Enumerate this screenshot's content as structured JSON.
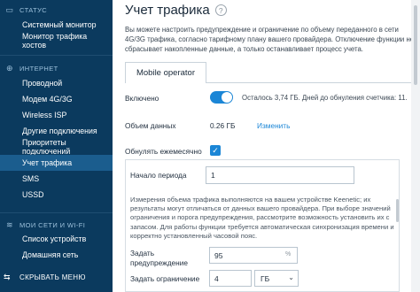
{
  "sidebar": {
    "status_header": "СТАТУС",
    "status_items": [
      "Системный монитор",
      "Монитор трафика хостов"
    ],
    "internet_header": "ИНТЕРНЕТ",
    "internet_items": [
      "Проводной",
      "Модем 4G/3G",
      "Wireless ISP",
      "Другие подключения",
      "Приоритеты подключений",
      "Учет трафика",
      "SMS",
      "USSD"
    ],
    "active_item": "Учет трафика",
    "wifi_header": "МОИ СЕТИ И WI-FI",
    "wifi_items": [
      "Список устройств",
      "Домашняя сеть"
    ],
    "collapse_label": "СКРЫВАТЬ МЕНЮ"
  },
  "main": {
    "title": "Учет трафика",
    "help_icon": "?",
    "intro": "Вы можете настроить предупреждение и ограничение по объему переданного в сети 4G/3G трафика, согласно тарифному плану вашего провайдера. Отключение функции не сбрасывает накопленные данные, а только останавливает процесс учета.",
    "tab_label": "Mobile operator",
    "enabled_label": "Включено",
    "enabled_state": true,
    "status_text": "Осталось 3,74 ГБ. Дней до обнуления счетчика: 11.",
    "data_volume_label": "Объем данных",
    "data_volume_value": "0.26 ГБ",
    "change_link": "Изменить",
    "reset_monthly_label": "Обнулять ежемесячно",
    "reset_monthly_checked": true,
    "period_start_label": "Начало периода",
    "period_start_value": "1",
    "note": "Измерения объема трафика выполняются на вашем устройстве Keenetic; их результаты могут отличаться от данных вашего провайдера. При выборе значений ограничения и порога предупреждения, рассмотрите возможность установить их с запасом. Для работы функции требуется автоматическая синхронизация времени и корректно установленный часовой пояс.",
    "warning_label": "Задать предупреждение",
    "warning_value": "95",
    "warning_suffix": "%",
    "limit_label": "Задать ограничение",
    "limit_value": "4",
    "limit_unit": "ГБ"
  },
  "colors": {
    "sidebar_bg": "#0b3a5e",
    "active_bg": "#1b5d8e",
    "accent": "#1b86d6"
  }
}
